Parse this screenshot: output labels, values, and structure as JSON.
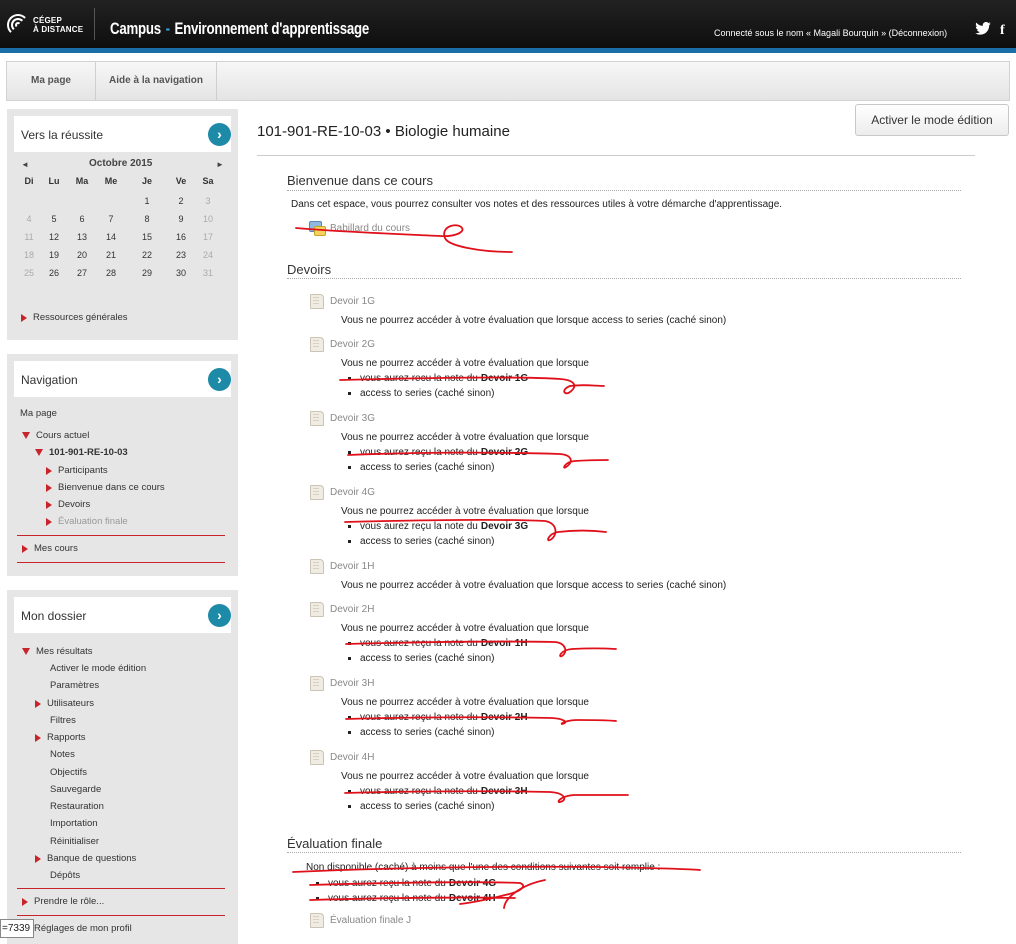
{
  "header": {
    "logo_line1": "CÉGEP",
    "logo_line2": "À DISTANCE",
    "app_name": "Campus",
    "app_sep": "-",
    "app_subtitle": "Environnement d'apprentissage",
    "login_text": "Connecté sous le nom « Magali Bourquin » (Déconnexion)",
    "twitter_icon": "twitter-icon",
    "facebook_icon": "facebook-icon",
    "stripe_color": "#1a6ea8"
  },
  "nav": {
    "items": [
      {
        "label": "Ma page"
      },
      {
        "label": "Aide à la navigation"
      }
    ]
  },
  "edit_button": "Activer le mode édition",
  "blocks": {
    "success": {
      "title": "Vers la réussite",
      "calendar": {
        "month": "Octobre 2015",
        "prev": "◄",
        "next": "►",
        "days": [
          "Di",
          "Lu",
          "Ma",
          "Me",
          "Je",
          "Ve",
          "Sa"
        ],
        "weeks": [
          [
            "",
            "",
            "",
            "",
            "1",
            "2",
            "3"
          ],
          [
            "4",
            "5",
            "6",
            "7",
            "8",
            "9",
            "10"
          ],
          [
            "11",
            "12",
            "13",
            "14",
            "15",
            "16",
            "17"
          ],
          [
            "18",
            "19",
            "20",
            "21",
            "22",
            "23",
            "24"
          ],
          [
            "25",
            "26",
            "27",
            "28",
            "29",
            "30",
            "31"
          ]
        ]
      },
      "resources": "Ressources générales"
    },
    "navigation": {
      "title": "Navigation",
      "my_page": "Ma page",
      "current_course": "Cours actuel",
      "course_code": "101-901-RE-10-03",
      "items": [
        "Participants",
        "Bienvenue dans ce cours",
        "Devoirs",
        "Évaluation finale"
      ],
      "my_courses": "Mes cours"
    },
    "dossier": {
      "title": "Mon dossier",
      "results": "Mes résultats",
      "items": [
        "Activer le mode édition",
        "Paramètres",
        "Utilisateurs",
        "Filtres",
        "Rapports",
        "Notes",
        "Objectifs",
        "Sauvegarde",
        "Restauration",
        "Importation",
        "Réinitialiser",
        "Banque de questions",
        "Dépôts"
      ],
      "switch_role": "Prendre le rôle...",
      "profile_settings": "Réglages de mon profil"
    }
  },
  "tooltip": "=7339",
  "main": {
    "course_title": "101-901-RE-10-03 • Biologie humaine",
    "welcome": {
      "heading": "Bienvenue dans ce cours",
      "text": "Dans cet espace, vous pourrez consulter vos notes et des ressources utiles à votre démarche d'apprentissage.",
      "forum": "Babillard du cours"
    },
    "assignments": {
      "heading": "Devoirs",
      "restriction_single": "Vous ne pourrez accéder à votre évaluation que lorsque access to series (caché sinon)",
      "restriction_intro": "Vous ne pourrez accéder à votre évaluation que lorsque",
      "grade_prefix_1": "vous aurez recu la note du",
      "grade_prefix_2": "vous aurez reçu la note du",
      "series_access": "access to series (caché sinon)",
      "items": [
        {
          "name": "Devoir 1G",
          "prereq": ""
        },
        {
          "name": "Devoir 2G",
          "prereq": "Devoir 1G"
        },
        {
          "name": "Devoir 3G",
          "prereq": "Devoir 2G"
        },
        {
          "name": "Devoir 4G",
          "prereq": "Devoir 3G"
        },
        {
          "name": "Devoir 1H",
          "prereq": ""
        },
        {
          "name": "Devoir 2H",
          "prereq": "Devoir 1H"
        },
        {
          "name": "Devoir 3H",
          "prereq": "Devoir 2H"
        },
        {
          "name": "Devoir 4H",
          "prereq": "Devoir 3H"
        }
      ]
    },
    "final": {
      "heading": "Évaluation finale",
      "unavailable": "Non disponible (caché) à moins que l'une des conditions suivantes soit remplie :",
      "grade_prefix": "vous aurez reçu la note du",
      "cond1": "Devoir 4G",
      "cond2": "Devoir 4H",
      "item": "Évaluation finale J"
    }
  }
}
